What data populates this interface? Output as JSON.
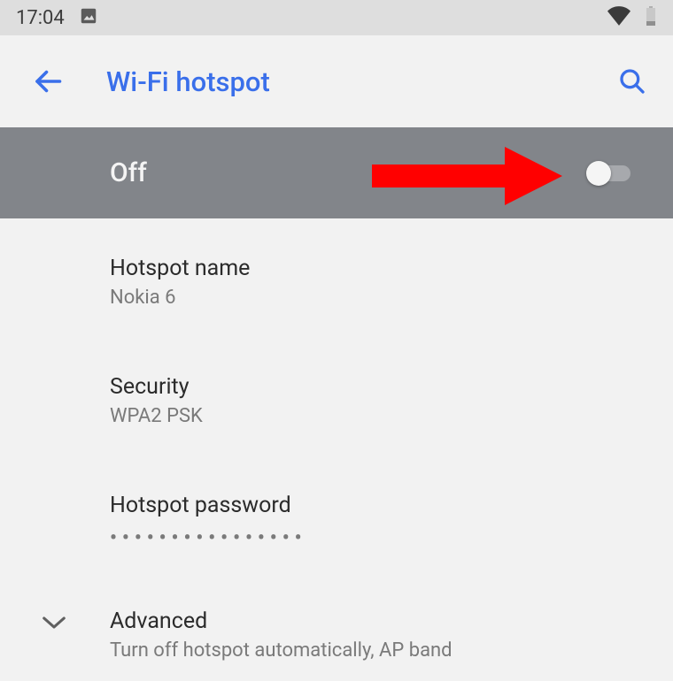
{
  "statusBar": {
    "time": "17:04"
  },
  "header": {
    "title": "Wi-Fi hotspot"
  },
  "toggle": {
    "label": "Off",
    "state": "off"
  },
  "items": {
    "hotspotName": {
      "title": "Hotspot name",
      "value": "Nokia 6"
    },
    "security": {
      "title": "Security",
      "value": "WPA2 PSK"
    },
    "password": {
      "title": "Hotspot password",
      "masked": "••••••••••••••••"
    },
    "advanced": {
      "title": "Advanced",
      "subtitle": "Turn off hotspot automatically, AP band"
    }
  }
}
